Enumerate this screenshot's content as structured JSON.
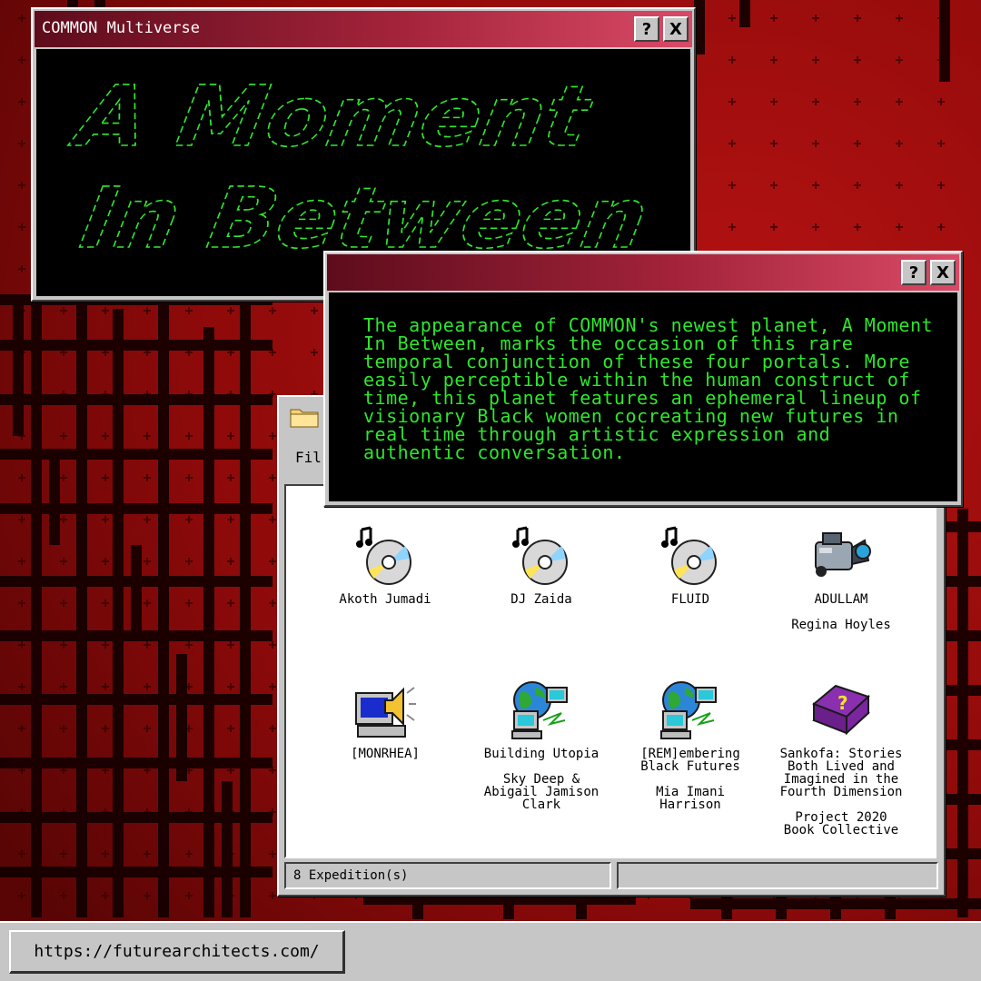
{
  "colors": {
    "background_red": "#8f0a0a",
    "terminal_green": "#2ee62e",
    "title_gradient_start": "#5e0c1c",
    "title_gradient_end": "#d94a66"
  },
  "window_main": {
    "title": "COMMON Multiverse",
    "help_label": "?",
    "close_label": "X",
    "ascii_lines": [
      "A Moment",
      "In Between"
    ]
  },
  "window_description": {
    "help_label": "?",
    "close_label": "X",
    "text": "The appearance of COMMON's newest planet, A Moment In Between, marks the occasion of this rare temporal conjunction of these four portals. More easily perceptible within the human construct of time, this planet features an ephemeral lineup of visionary Black women cocreating new futures in real time through artistic expression and authentic conversation."
  },
  "window_explorer": {
    "menu_partial": "Fil",
    "items": [
      {
        "icon": "cd-music-icon",
        "label": "Akoth Jumadi",
        "sub": ""
      },
      {
        "icon": "cd-music-icon",
        "label": "DJ Zaida",
        "sub": ""
      },
      {
        "icon": "cd-music-icon",
        "label": "FLUID",
        "sub": ""
      },
      {
        "icon": "video-camera-icon",
        "label": "ADULLAM",
        "sub": "Regina Hoyles"
      },
      {
        "icon": "computer-speaker-icon",
        "label": "[MONRHEA]",
        "sub": ""
      },
      {
        "icon": "network-globe-icon",
        "label": "Building Utopia",
        "sub": "Sky Deep &\nAbigail Jamison\nClark"
      },
      {
        "icon": "network-globe-icon",
        "label": "[REM]embering\nBlack Futures",
        "sub": "Mia Imani\nHarrison"
      },
      {
        "icon": "help-book-icon",
        "label": "Sankofa: Stories\nBoth Lived and\nImagined in the\nFourth Dimension",
        "sub": "Project 2020\nBook Collective"
      }
    ],
    "status_count": "8 Expedition(s)",
    "status_right": ""
  },
  "taskbar": {
    "url": "https://futurearchitects.com/"
  }
}
